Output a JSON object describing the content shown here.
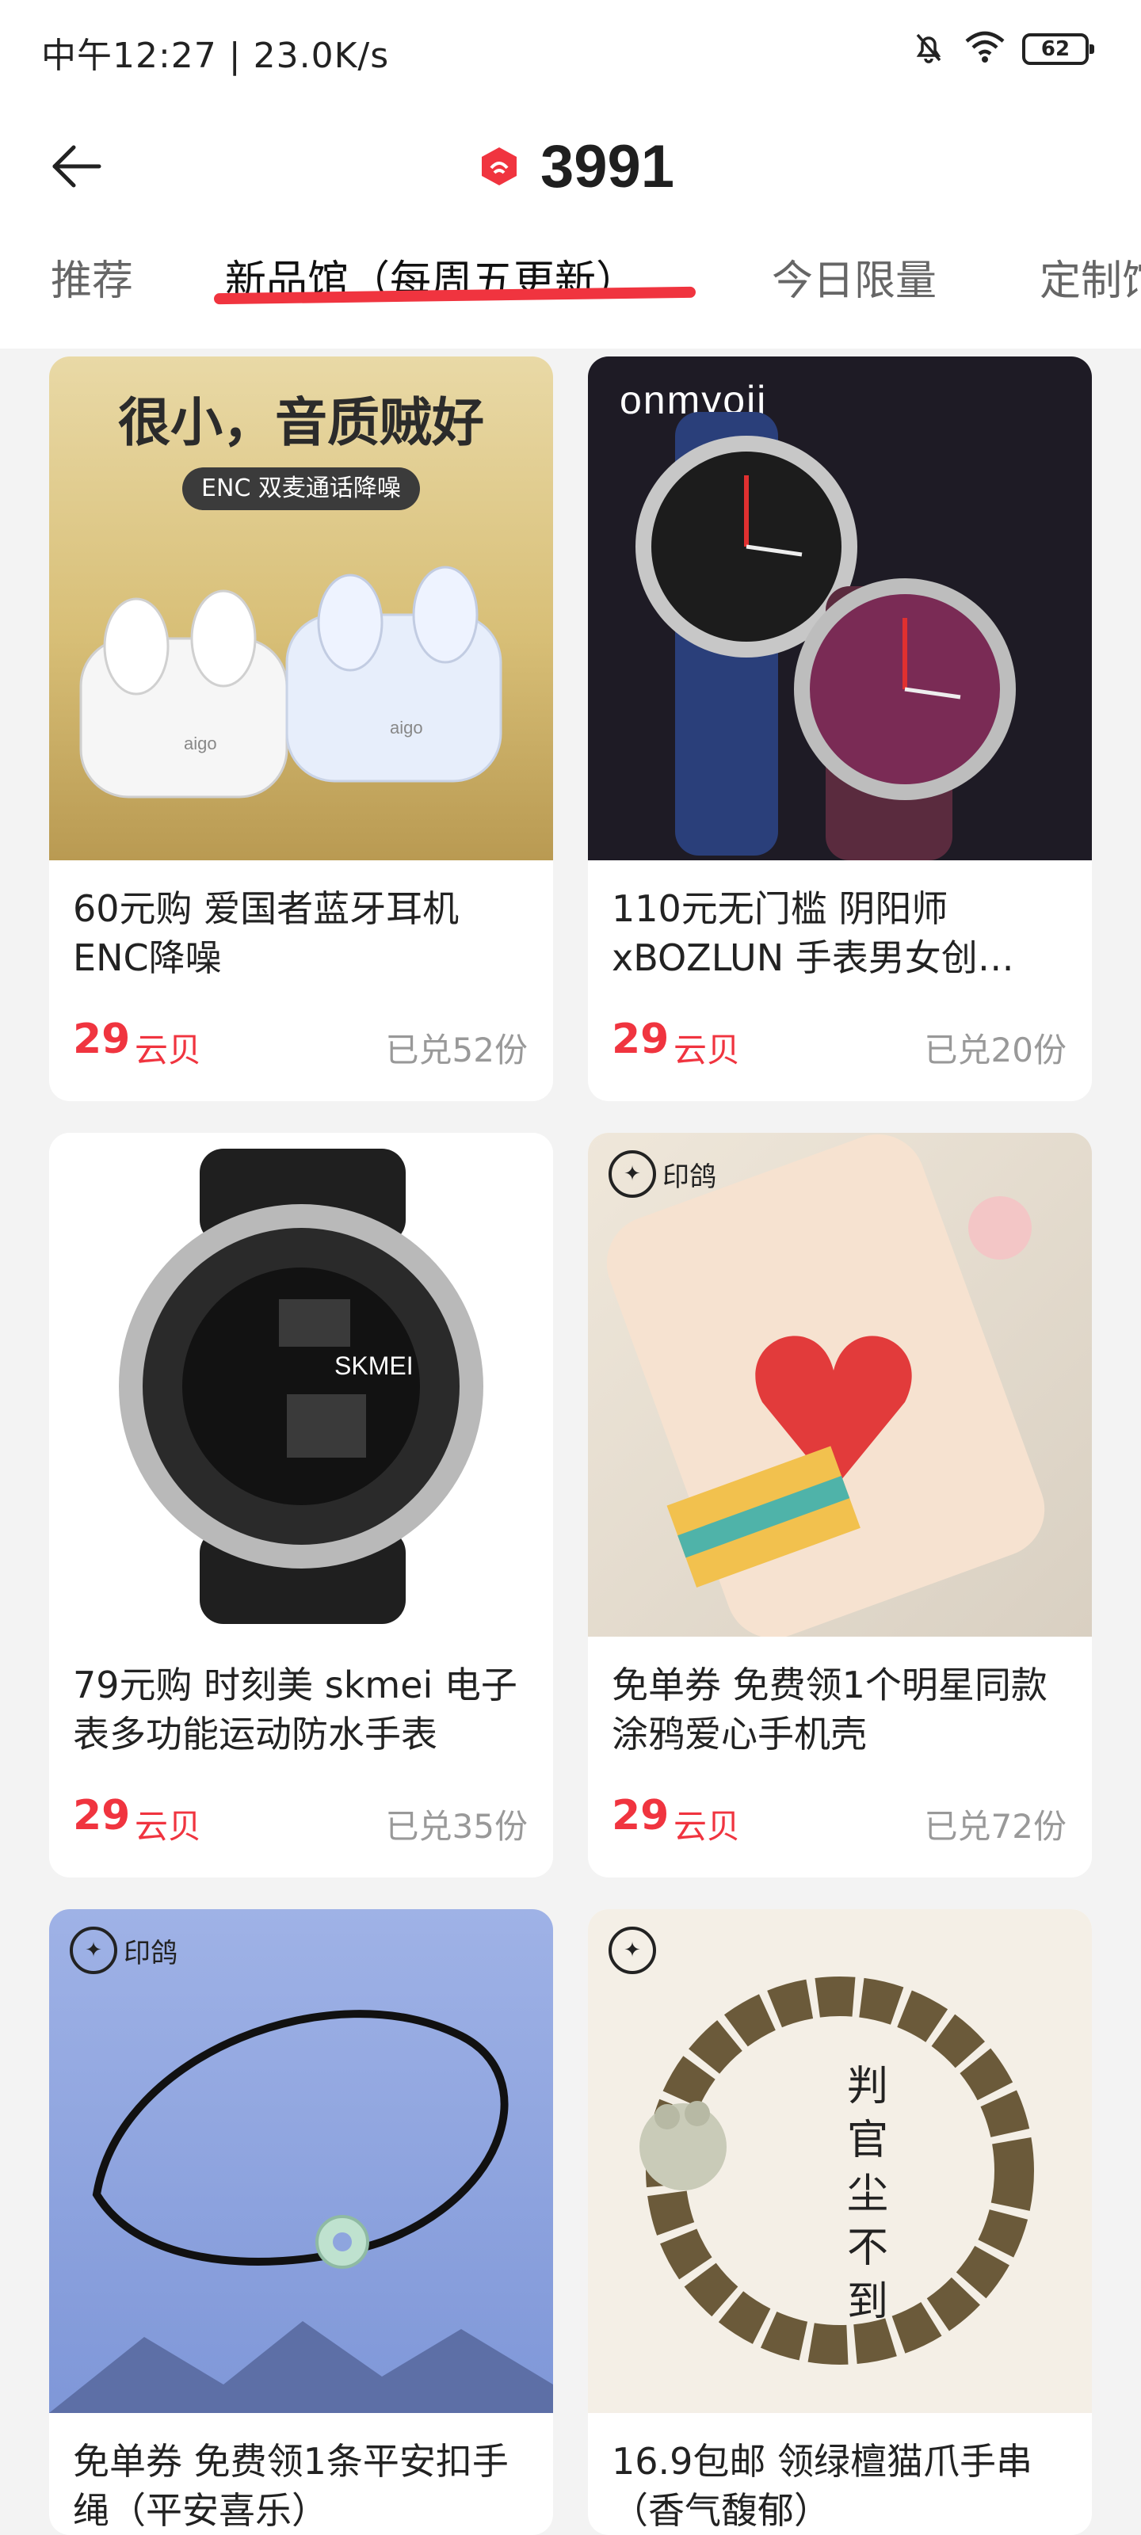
{
  "status_bar": {
    "time_speed": "中午12:27 | 23.0K/s",
    "battery": "62",
    "icons": [
      "bell-off-icon",
      "wifi-icon",
      "battery-icon"
    ]
  },
  "header": {
    "back_icon": "back-arrow-icon",
    "coin_icon": "cloud-shell-coin-icon",
    "points": "3991"
  },
  "tabs": [
    {
      "label": "推荐",
      "active": false
    },
    {
      "label": "新品馆（每周五更新）",
      "active": true
    },
    {
      "label": "今日限量",
      "active": false
    },
    {
      "label": "定制馆",
      "active": false
    }
  ],
  "colors": {
    "accent": "#f0343f",
    "background": "#f3f3f3",
    "card": "#ffffff"
  },
  "products": [
    {
      "name": "60元购 爱国者蓝牙耳机ENC降噪",
      "price": "29",
      "unit": "云贝",
      "sold": "已兑52份",
      "image_text": "很小，音质贼好",
      "image_subtext": "ENC 双麦通话降噪",
      "image_brand": "aigo"
    },
    {
      "name": "110元无门槛 阴阳师xBOZLUN 手表男女创…",
      "price": "29",
      "unit": "云贝",
      "sold": "已兑20份",
      "image_text": "onmyoji"
    },
    {
      "name": "79元购 时刻美 skmei 电子表多功能运动防水手表",
      "price": "29",
      "unit": "云贝",
      "sold": "已兑35份",
      "image_text": "SKMEI"
    },
    {
      "name": "免单券 免费领1个明星同款涂鸦爱心手机壳",
      "price": "29",
      "unit": "云贝",
      "sold": "已兑72份",
      "image_text": "印鸽"
    },
    {
      "name": "免单券 免费领1条平安扣手绳（平安喜乐）",
      "price": "",
      "unit": "",
      "sold": "",
      "image_text": "印鸽"
    },
    {
      "name": "16.9包邮 领绿檀猫爪手串（香气馥郁）",
      "price": "",
      "unit": "",
      "sold": "",
      "image_text": "判官尘不到"
    }
  ]
}
